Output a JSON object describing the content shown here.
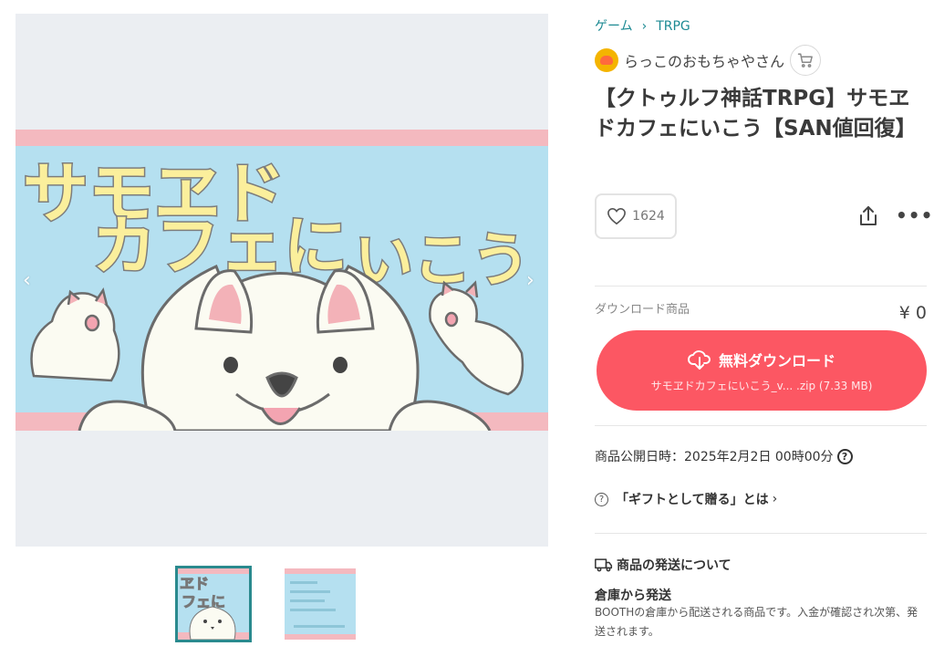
{
  "breadcrumb": {
    "items": [
      "ゲーム",
      "TRPG"
    ],
    "separator": "›"
  },
  "shop": {
    "name": "らっこのおもちゃやさん",
    "cart_icon": "cart-icon"
  },
  "product": {
    "title": "【クトゥルフ神話TRPG】サモヱドカフェにいこう【SAN値回復】",
    "likes": "1624",
    "banner_text_line1": "サモヱド",
    "banner_text_line2": "カフェに",
    "banner_text_line3": "いこう"
  },
  "download": {
    "label": "ダウンロード商品",
    "price": "¥ 0",
    "button_label": "無料ダウンロード",
    "file": "サモヱドカフェにいこう_v... .zip (7.33 MB)"
  },
  "published": {
    "text": "商品公開日時：2025年2月2日 00時00分"
  },
  "gift": {
    "text": "「ギフトとして贈る」とは",
    "chevron": "›",
    "help_glyph": "?"
  },
  "shipping": {
    "heading": "商品の発送について",
    "method": "倉庫から発送",
    "description": "BOOTHの倉庫から配送される商品です。入金が確認され次第、発送されます。"
  },
  "gallery": {
    "prev": "‹",
    "next": "›"
  },
  "colors": {
    "accent": "#fc5763",
    "link": "#1c8a93",
    "banner_sky": "#b5e0f0",
    "banner_stripe": "#f4b9bf",
    "banner_text": "#fbef9c"
  }
}
